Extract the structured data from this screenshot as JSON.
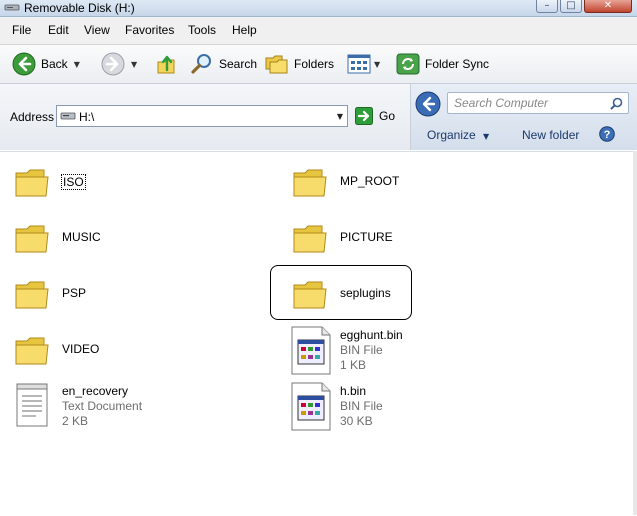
{
  "window": {
    "title": "Removable Disk (H:)",
    "controls": [
      "minimize",
      "maximize",
      "close"
    ]
  },
  "menu": [
    "File",
    "Edit",
    "View",
    "Favorites",
    "Tools",
    "Help"
  ],
  "toolbar": {
    "back_label": "Back",
    "search_label": "Search",
    "folders_label": "Folders",
    "folder_sync_label": "Folder Sync"
  },
  "address": {
    "label": "Address",
    "value": "H:\\",
    "go_label": "Go"
  },
  "search": {
    "placeholder": "Search Computer"
  },
  "commands": {
    "organize_label": "Organize",
    "new_folder_label": "New folder"
  },
  "items": [
    {
      "name": "ISO",
      "type": "folder"
    },
    {
      "name": "MP_ROOT",
      "type": "folder"
    },
    {
      "name": "MUSIC",
      "type": "folder"
    },
    {
      "name": "PICTURE",
      "type": "folder"
    },
    {
      "name": "PSP",
      "type": "folder"
    },
    {
      "name": "seplugins",
      "type": "folder",
      "selected": true
    },
    {
      "name": "VIDEO",
      "type": "folder"
    },
    {
      "name": "egghunt.bin",
      "type": "BIN File",
      "size": "1 KB"
    },
    {
      "name": "en_recovery",
      "type": "Text Document",
      "size": "2 KB"
    },
    {
      "name": "h.bin",
      "type": "BIN File",
      "size": "30 KB"
    }
  ],
  "colors": {
    "folder": "#f2d55a",
    "accent": "#1b3a6b",
    "go_green": "#2f9e3a"
  }
}
